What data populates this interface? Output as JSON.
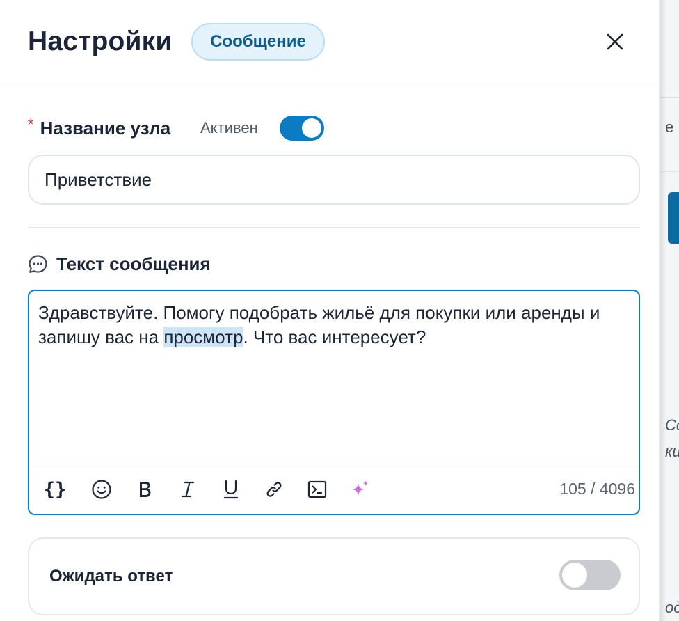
{
  "header": {
    "title": "Настройки",
    "badge": "Сообщение"
  },
  "node_name": {
    "label": "Название узла",
    "required": true,
    "active_label": "Активен",
    "active": true,
    "value": "Приветствие"
  },
  "message": {
    "label": "Текст сообщения",
    "text_before": "Здравствуйте. Помогу подобрать жильё для покупки или аренды и запишу вас на ",
    "text_selected": "просмотр",
    "text_after": ". Что вас интересует?",
    "char_count": "105 / 4096",
    "toolbar": [
      "variables-icon",
      "emoji-icon",
      "bold-icon",
      "italic-icon",
      "underline-icon",
      "link-icon",
      "code-icon",
      "ai-sparkle-icon"
    ]
  },
  "wait_reply": {
    "label": "Ожидать ответ",
    "enabled": false
  },
  "background": {
    "fragments": [
      "е",
      "Сс",
      "ки",
      "од"
    ]
  },
  "colors": {
    "accent": "#0b7bc4",
    "badge_bg": "#e3f2fb",
    "badge_text": "#0f5c8f",
    "required": "#d4343b",
    "toggle_off": "#c9cbd0",
    "selection": "#cfe4f6"
  }
}
